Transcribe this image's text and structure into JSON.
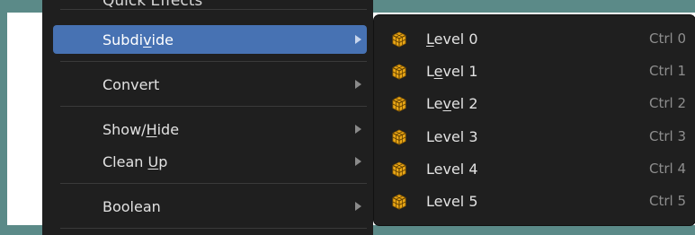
{
  "menu": {
    "clipped_item": "Quick Effects",
    "items": [
      {
        "label_pre": "Subdi",
        "label_ul": "v",
        "label_post": "ide",
        "active": true,
        "has_submenu": true
      },
      {
        "label_pre": "Convert",
        "label_ul": "",
        "label_post": "",
        "has_submenu": true
      },
      {
        "label_pre": "Show/",
        "label_ul": "H",
        "label_post": "ide",
        "has_submenu": true
      },
      {
        "label_pre": "Clean ",
        "label_ul": "U",
        "label_post": "p",
        "has_submenu": true
      },
      {
        "label_pre": "Boolean",
        "label_ul": "",
        "label_post": "",
        "has_submenu": true
      }
    ]
  },
  "submenu": {
    "icon": "subdivision-cube-icon",
    "icon_color": "#e8a616",
    "items": [
      {
        "label_pre": "",
        "label_ul": "L",
        "label_post": "evel 0",
        "shortcut": "Ctrl 0"
      },
      {
        "label_pre": "L",
        "label_ul": "e",
        "label_post": "vel 1",
        "shortcut": "Ctrl 1"
      },
      {
        "label_pre": "Le",
        "label_ul": "v",
        "label_post": "el 2",
        "shortcut": "Ctrl 2"
      },
      {
        "label_pre": "Level 3",
        "label_ul": "",
        "label_post": "",
        "shortcut": "Ctrl 3"
      },
      {
        "label_pre": "Level 4",
        "label_ul": "",
        "label_post": "",
        "shortcut": "Ctrl 4"
      },
      {
        "label_pre": "Level 5",
        "label_ul": "",
        "label_post": "",
        "shortcut": "Ctrl 5"
      }
    ]
  }
}
